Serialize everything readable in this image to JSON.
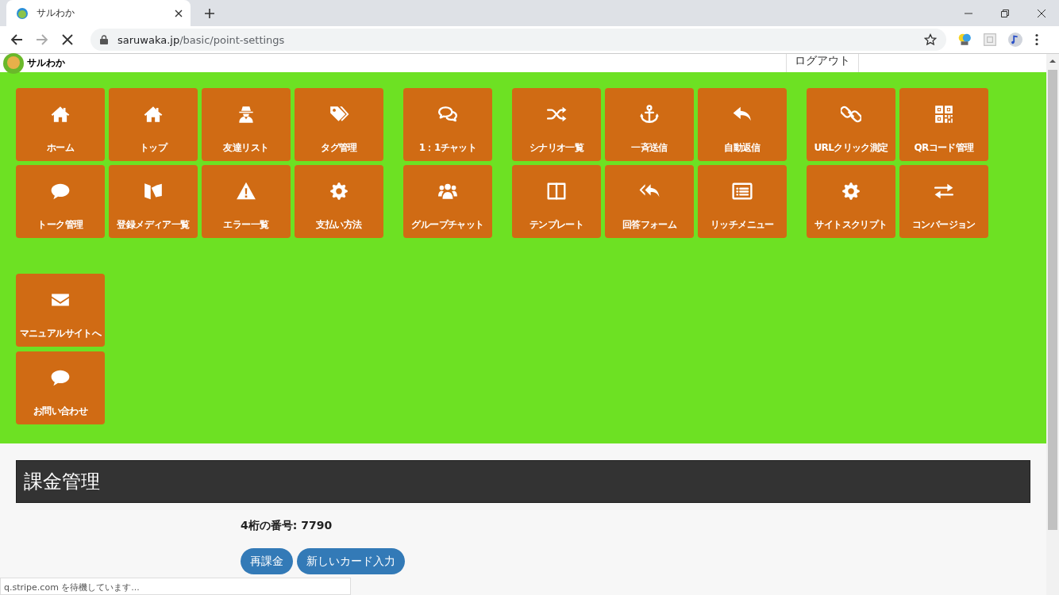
{
  "browser": {
    "tab_title": "サルわか",
    "url_host": "saruwaka.jp",
    "url_path": "/basic/point-settings",
    "status_text": "q.stripe.com を待機しています..."
  },
  "header": {
    "logo_text": "サルわか",
    "logout": "ログアウト"
  },
  "menu_groups": [
    {
      "rows": [
        [
          {
            "kind": "home",
            "label": "ホーム"
          },
          {
            "kind": "home",
            "label": "トップ"
          },
          {
            "kind": "spy",
            "label": "友達リスト"
          },
          {
            "kind": "tags",
            "label": "タグ管理"
          }
        ],
        [
          {
            "kind": "bubble",
            "label": "トーク管理"
          },
          {
            "kind": "book",
            "label": "登録メディア一覧"
          },
          {
            "kind": "warning",
            "label": "エラー一覧"
          },
          {
            "kind": "gear",
            "label": "支払い方法"
          }
        ]
      ]
    },
    {
      "rows": [
        [
          {
            "kind": "bubbles",
            "label": "1：1チャット"
          }
        ],
        [
          {
            "kind": "people",
            "label": "グループチャット"
          }
        ]
      ]
    },
    {
      "rows": [
        [
          {
            "kind": "shuffle",
            "label": "シナリオ一覧"
          },
          {
            "kind": "anchor",
            "label": "一斉送信"
          },
          {
            "kind": "reply",
            "label": "自動返信"
          }
        ],
        [
          {
            "kind": "columns",
            "label": "テンプレート"
          },
          {
            "kind": "replyall",
            "label": "回答フォーム"
          },
          {
            "kind": "list",
            "label": "リッチメニュー"
          }
        ]
      ]
    },
    {
      "rows": [
        [
          {
            "kind": "link",
            "label": "URLクリック測定"
          },
          {
            "kind": "qrcode",
            "label": "QRコード管理"
          }
        ],
        [
          {
            "kind": "gear",
            "label": "サイトスクリプト"
          },
          {
            "kind": "swap",
            "label": "コンバージョン"
          }
        ]
      ]
    }
  ],
  "extra_tiles": [
    {
      "kind": "envelope",
      "label": "マニュアルサイトへ"
    },
    {
      "kind": "bubble",
      "label": "お問い合わせ"
    }
  ],
  "section": {
    "title": "課金管理",
    "card_info": "4桁の番号: 7790",
    "buttons": [
      "再課金",
      "新しいカード入力"
    ]
  }
}
